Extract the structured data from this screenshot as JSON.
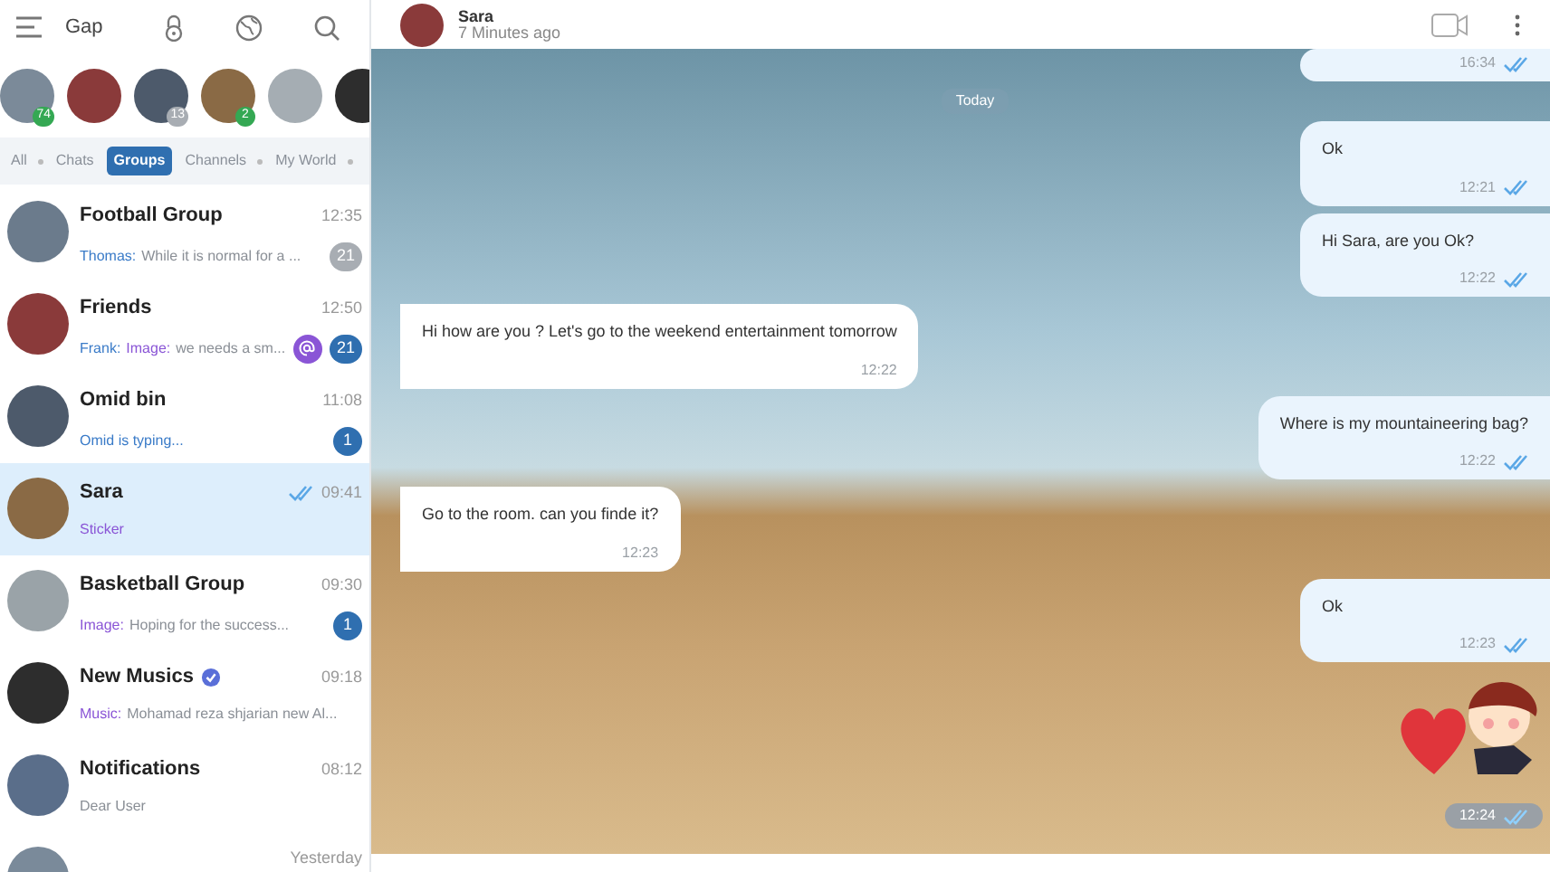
{
  "app": {
    "title": "Gap"
  },
  "stories": [
    {
      "kind": "counted",
      "badge": "74",
      "muted": false
    },
    {
      "kind": "plain"
    },
    {
      "kind": "counted",
      "badge": "13",
      "muted": true
    },
    {
      "kind": "counted",
      "badge": "2",
      "muted": false
    },
    {
      "kind": "plain"
    },
    {
      "kind": "plain"
    }
  ],
  "tabs": [
    {
      "label": "All",
      "selected": false,
      "dot": true
    },
    {
      "label": "Chats",
      "selected": false,
      "dot": false
    },
    {
      "label": "Groups",
      "selected": true,
      "dot": false
    },
    {
      "label": "Channels",
      "selected": false,
      "dot": true
    },
    {
      "label": "My World",
      "selected": false,
      "dot": true
    }
  ],
  "chats": [
    {
      "name": "Football Group",
      "time": "12:35",
      "verified": false,
      "read": false,
      "selected": false,
      "preview": [
        {
          "kind": "sender",
          "text": "Thomas:"
        },
        {
          "kind": "plain",
          "text": "While it is normal for a ..."
        }
      ],
      "mention": false,
      "unread": "21",
      "muted": true
    },
    {
      "name": "Friends",
      "time": "12:50",
      "verified": false,
      "read": false,
      "selected": false,
      "preview": [
        {
          "kind": "sender",
          "text": "Frank:"
        },
        {
          "kind": "media",
          "text": "Image:"
        },
        {
          "kind": "plain",
          "text": "we needs a sm..."
        }
      ],
      "mention": true,
      "unread": "21",
      "muted": false
    },
    {
      "name": "Omid bin",
      "time": "11:08",
      "verified": false,
      "read": false,
      "selected": false,
      "preview": [
        {
          "kind": "typing",
          "text": "Omid is typing..."
        }
      ],
      "mention": false,
      "unread": "1",
      "muted": false
    },
    {
      "name": "Sara",
      "time": "09:41",
      "verified": false,
      "read": true,
      "selected": true,
      "preview": [
        {
          "kind": "media",
          "text": "Sticker"
        }
      ],
      "mention": false
    },
    {
      "name": "Basketball Group",
      "time": "09:30",
      "verified": false,
      "read": false,
      "selected": false,
      "preview": [
        {
          "kind": "media",
          "text": "Image:"
        },
        {
          "kind": "plain",
          "text": "Hoping for the success..."
        }
      ],
      "mention": false,
      "unread": "1",
      "muted": false
    },
    {
      "name": "New Musics",
      "time": "09:18",
      "verified": true,
      "read": false,
      "selected": false,
      "preview": [
        {
          "kind": "media",
          "text": "Music:"
        },
        {
          "kind": "plain",
          "text": "Mohamad reza shjarian new Al..."
        }
      ],
      "mention": false
    },
    {
      "name": "Notifications",
      "time": "08:12",
      "verified": false,
      "read": false,
      "selected": false,
      "preview": [
        {
          "kind": "plain",
          "text": "Dear User"
        }
      ],
      "mention": false
    },
    {
      "time": "Yesterday",
      "verified": false,
      "read": false,
      "selected": false,
      "mention": false
    }
  ],
  "conversation": {
    "name": "Sara",
    "status": "7 Minutes ago"
  },
  "date_separator": "Today",
  "messages": [
    {
      "kind": "text",
      "outgoing": true,
      "time": "16:34",
      "read": true
    },
    {
      "kind": "date"
    },
    {
      "kind": "text",
      "outgoing": true,
      "text": "Ok",
      "time": "12:21",
      "read": true
    },
    {
      "kind": "text",
      "outgoing": true,
      "text": "Hi Sara, are you Ok?",
      "time": "12:22",
      "read": true
    },
    {
      "kind": "text",
      "outgoing": false,
      "text": "Hi how are you ? Let's go to the weekend entertainment tomorrow",
      "time": "12:22",
      "read": false
    },
    {
      "kind": "text",
      "outgoing": true,
      "text": "Where is my mountaineering bag?",
      "time": "12:22",
      "read": true
    },
    {
      "kind": "text",
      "outgoing": false,
      "text": "Go to the room. can you finde it?",
      "time": "12:23",
      "read": false
    },
    {
      "kind": "text",
      "outgoing": true,
      "text": "Ok",
      "time": "12:23",
      "read": true
    },
    {
      "kind": "sticker",
      "outgoing": true,
      "time": "12:24",
      "read": true
    }
  ]
}
